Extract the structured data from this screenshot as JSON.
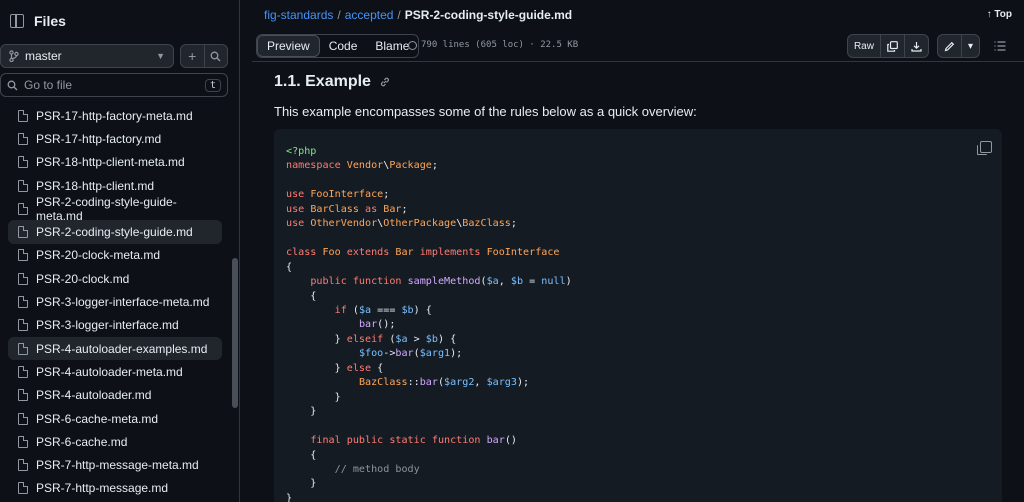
{
  "sidebar": {
    "title": "Files",
    "branch": "master",
    "goto_placeholder": "Go to file",
    "goto_kbd": "t",
    "files": [
      {
        "name": "PSR-17-http-factory-meta.md",
        "active": false
      },
      {
        "name": "PSR-17-http-factory.md",
        "active": false
      },
      {
        "name": "PSR-18-http-client-meta.md",
        "active": false
      },
      {
        "name": "PSR-18-http-client.md",
        "active": false
      },
      {
        "name": "PSR-2-coding-style-guide-meta.md",
        "active": false
      },
      {
        "name": "PSR-2-coding-style-guide.md",
        "active": true
      },
      {
        "name": "PSR-20-clock-meta.md",
        "active": false
      },
      {
        "name": "PSR-20-clock.md",
        "active": false
      },
      {
        "name": "PSR-3-logger-interface-meta.md",
        "active": false
      },
      {
        "name": "PSR-3-logger-interface.md",
        "active": false
      },
      {
        "name": "PSR-4-autoloader-examples.md",
        "active": true
      },
      {
        "name": "PSR-4-autoloader-meta.md",
        "active": false
      },
      {
        "name": "PSR-4-autoloader.md",
        "active": false
      },
      {
        "name": "PSR-6-cache-meta.md",
        "active": false
      },
      {
        "name": "PSR-6-cache.md",
        "active": false
      },
      {
        "name": "PSR-7-http-message-meta.md",
        "active": false
      },
      {
        "name": "PSR-7-http-message.md",
        "active": false
      }
    ]
  },
  "breadcrumb": {
    "repo": "fig-standards",
    "folder": "accepted",
    "file": "PSR-2-coding-style-guide.md"
  },
  "top_link": "Top",
  "toolbar": {
    "tabs": [
      "Preview",
      "Code",
      "Blame"
    ],
    "active_tab": "Preview",
    "meta": "790 lines (605 loc) · 22.5 KB",
    "raw_label": "Raw"
  },
  "content": {
    "heading": "1.1. Example",
    "paragraph": "This example encompasses some of the rules below as a quick overview:"
  }
}
